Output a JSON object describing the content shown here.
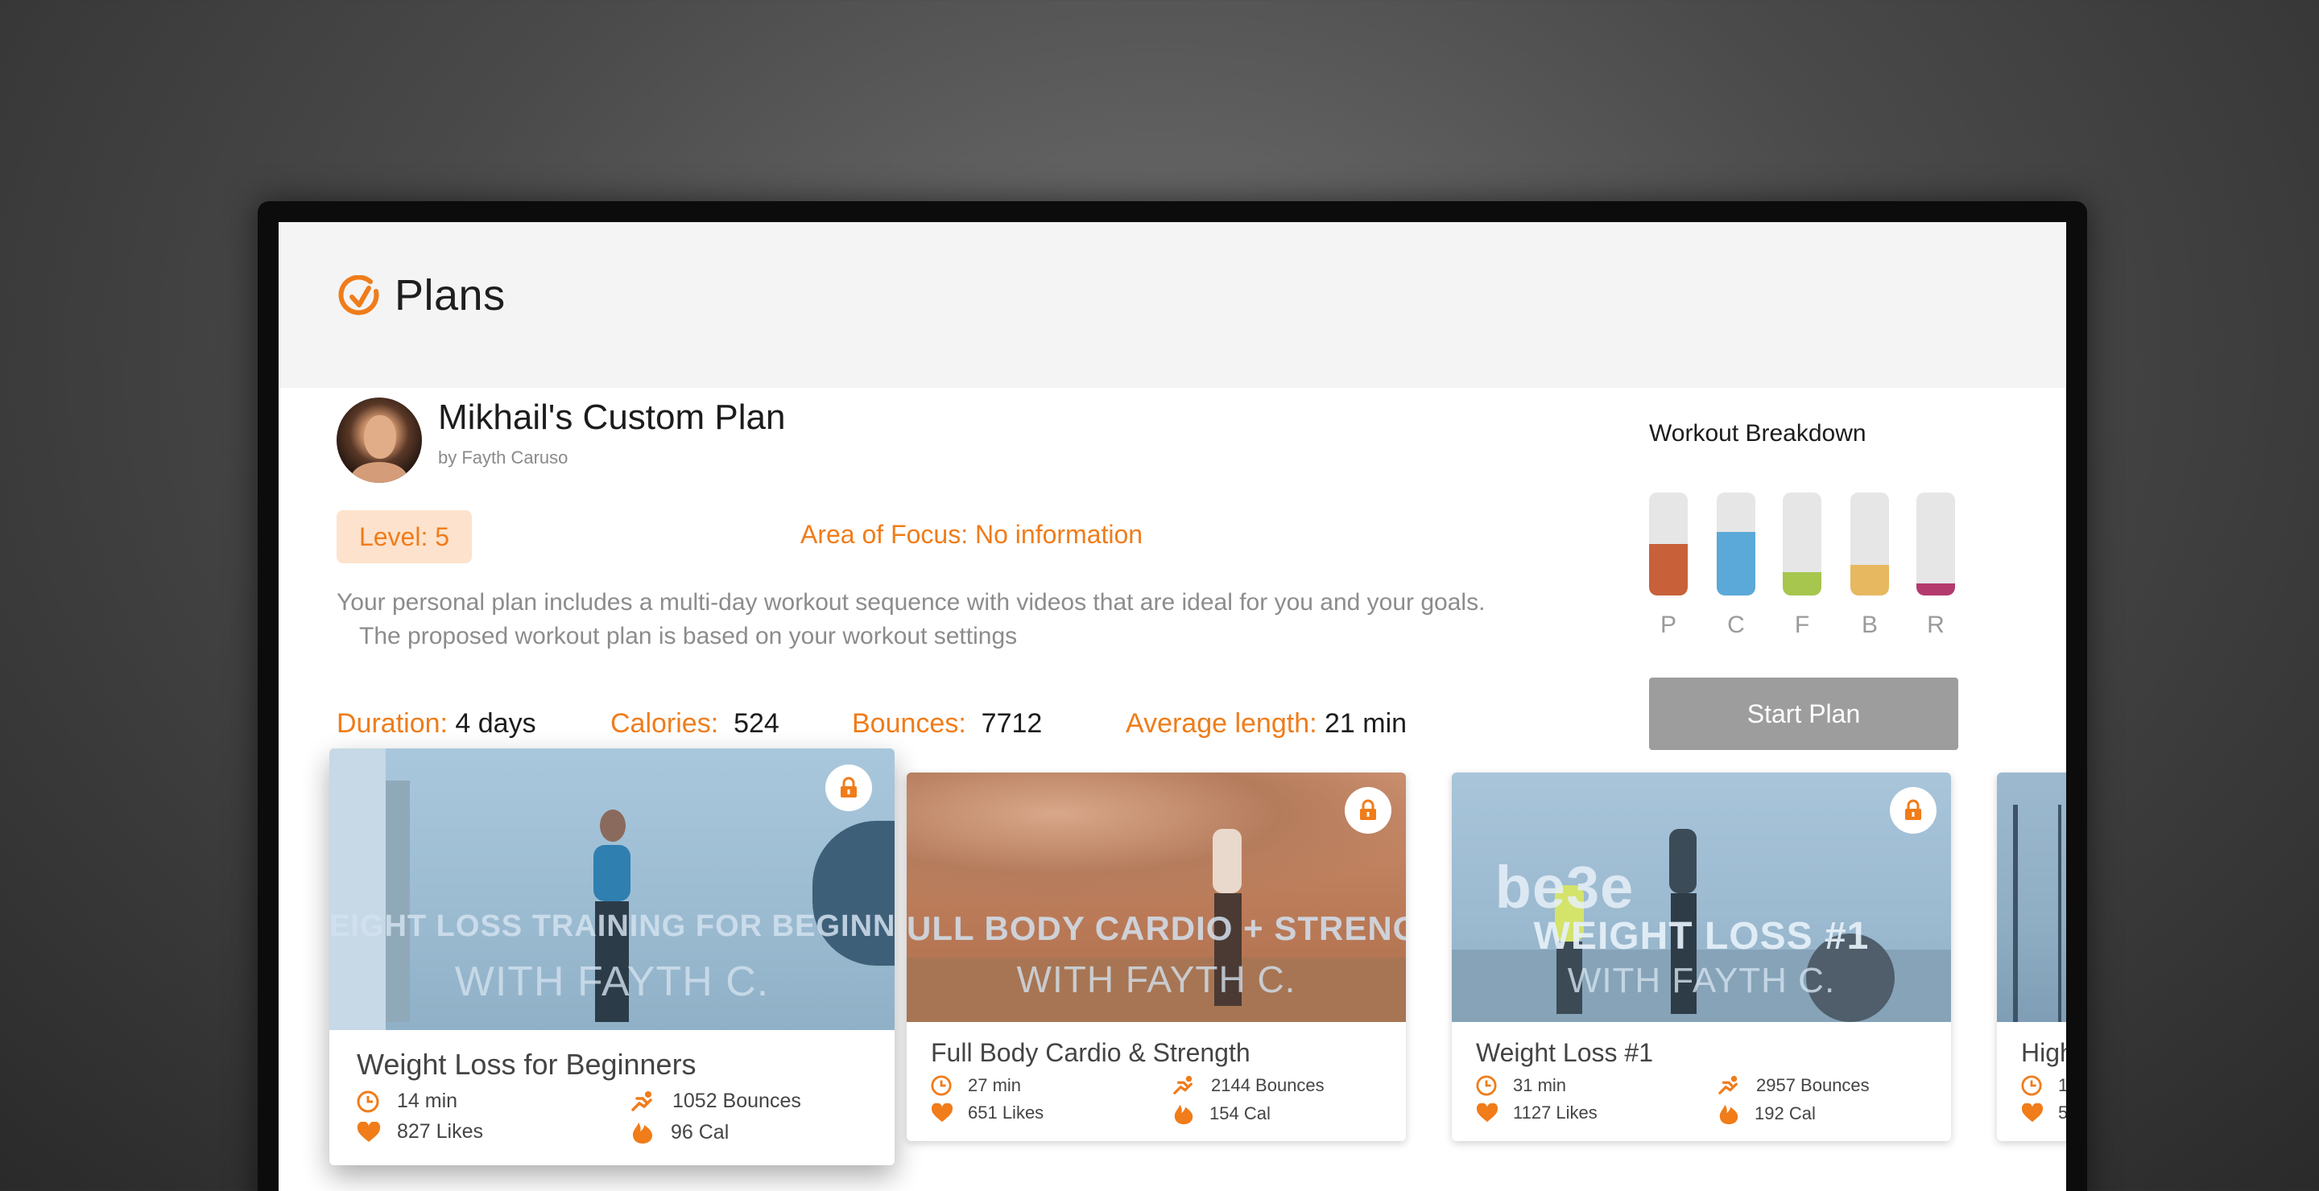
{
  "header": {
    "title": "Plans",
    "logo_icon": "check-circle-icon",
    "accent": "#f07c1a"
  },
  "plan": {
    "title": "Mikhail's Custom Plan",
    "author": "by Fayth Caruso",
    "level": "Level: 5",
    "focus": "Area of Focus: No information",
    "description_line1": "Your personal plan includes a multi-day workout sequence with videos that are ideal for you and your goals.",
    "description_line2": "The proposed workout plan is based on your workout settings"
  },
  "stats": {
    "duration_label": "Duration:",
    "duration_value": "4 days",
    "calories_label": "Calories:",
    "calories_value": "524",
    "bounces_label": "Bounces:",
    "bounces_value": "7712",
    "avg_label": "Average length:",
    "avg_value": "21 min"
  },
  "breakdown": {
    "title": "Workout Breakdown",
    "bars": [
      {
        "label": "P",
        "fraction": 0.5,
        "color": "#c8603a"
      },
      {
        "label": "C",
        "fraction": 0.62,
        "color": "#5aa9d8"
      },
      {
        "label": "F",
        "fraction": 0.23,
        "color": "#a6c64e"
      },
      {
        "label": "B",
        "fraction": 0.3,
        "color": "#e8b860"
      },
      {
        "label": "R",
        "fraction": 0.12,
        "color": "#b43a6e"
      }
    ]
  },
  "start_button": "Start Plan",
  "cards": [
    {
      "thumb_title": "EIGHT LOSS TRAINING FOR BEGINNE",
      "thumb_sub": "WITH FAYTH C.",
      "title": "Weight Loss for Beginners",
      "time": "14 min",
      "bounces": "1052 Bounces",
      "likes": "827 Likes",
      "cal": "96 Cal",
      "lock_icon": "lock-icon"
    },
    {
      "thumb_title": "ULL BODY CARDIO + STRENGT",
      "thumb_sub": "WITH FAYTH C.",
      "title": "Full Body Cardio & Strength",
      "time": "27 min",
      "bounces": "2144 Bounces",
      "likes": "651 Likes",
      "cal": "154 Cal",
      "lock_icon": "lock-icon"
    },
    {
      "thumb_title": "WEIGHT LOSS #1",
      "thumb_sub": "WITH FAYTH C.",
      "thumb_brand": "be3e",
      "title": "Weight Loss #1",
      "time": "31 min",
      "bounces": "2957 Bounces",
      "likes": "1127 Likes",
      "cal": "192 Cal",
      "lock_icon": "lock-icon"
    },
    {
      "title": "High",
      "time": "1",
      "likes": "5"
    }
  ]
}
